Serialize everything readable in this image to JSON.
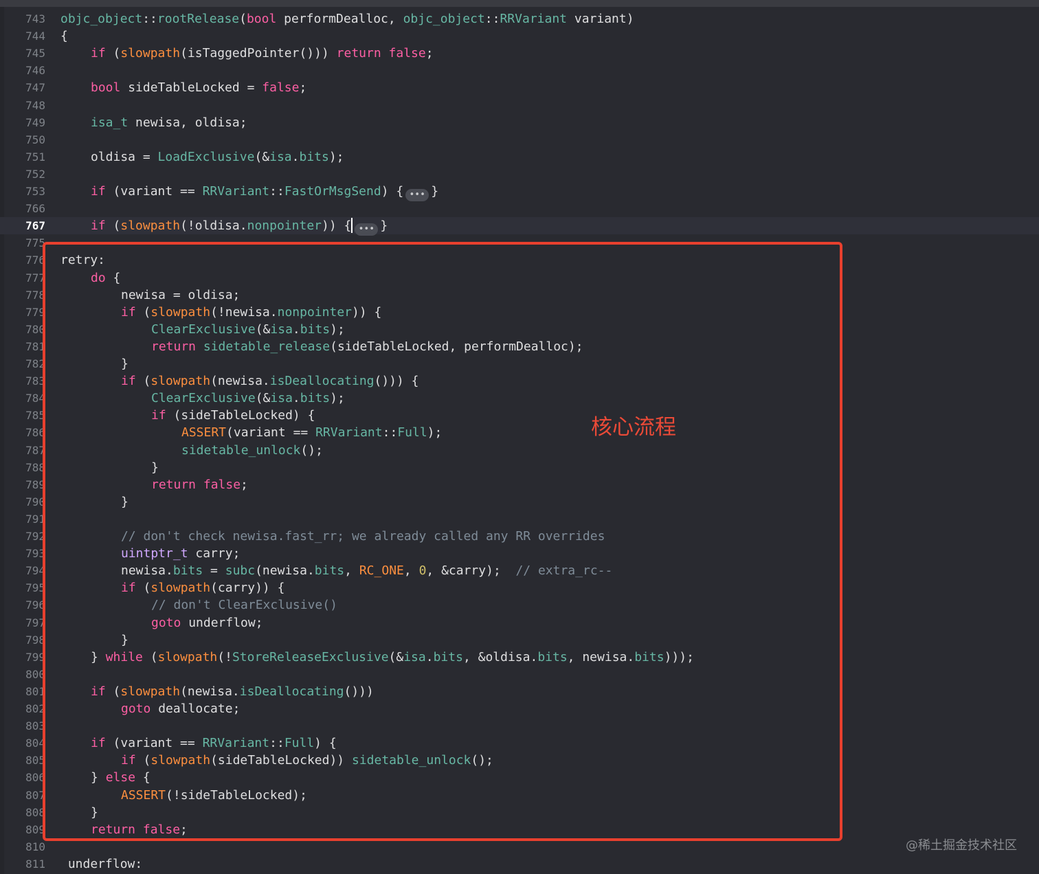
{
  "editor": {
    "current_line": "767",
    "fold_indicator": "•••"
  },
  "lines": [
    {
      "n": "743",
      "indent": 0,
      "tokens": [
        [
          "fn",
          "objc_object"
        ],
        [
          "pl",
          "::"
        ],
        [
          "fn",
          "rootRelease"
        ],
        [
          "pl",
          "("
        ],
        [
          "kw",
          "bool"
        ],
        [
          "pl",
          " performDealloc, "
        ],
        [
          "fn",
          "objc_object"
        ],
        [
          "pl",
          "::"
        ],
        [
          "fn",
          "RRVariant"
        ],
        [
          "pl",
          " variant)"
        ]
      ]
    },
    {
      "n": "744",
      "indent": 0,
      "tokens": [
        [
          "pl",
          "{"
        ]
      ]
    },
    {
      "n": "745",
      "indent": 1,
      "tokens": [
        [
          "kw",
          "if"
        ],
        [
          "pl",
          " ("
        ],
        [
          "mac",
          "slowpath"
        ],
        [
          "pl",
          "(isTaggedPointer())) "
        ],
        [
          "kw",
          "return false"
        ],
        [
          "pl",
          ";"
        ]
      ]
    },
    {
      "n": "746",
      "indent": 0,
      "tokens": []
    },
    {
      "n": "747",
      "indent": 1,
      "tokens": [
        [
          "kw",
          "bool"
        ],
        [
          "pl",
          " sideTableLocked = "
        ],
        [
          "kw",
          "false"
        ],
        [
          "pl",
          ";"
        ]
      ]
    },
    {
      "n": "748",
      "indent": 0,
      "tokens": []
    },
    {
      "n": "749",
      "indent": 1,
      "tokens": [
        [
          "fn",
          "isa_t"
        ],
        [
          "pl",
          " newisa, oldisa;"
        ]
      ]
    },
    {
      "n": "750",
      "indent": 0,
      "tokens": []
    },
    {
      "n": "751",
      "indent": 1,
      "tokens": [
        [
          "pl",
          "oldisa = "
        ],
        [
          "fn",
          "LoadExclusive"
        ],
        [
          "pl",
          "(&"
        ],
        [
          "fn",
          "isa"
        ],
        [
          "pl",
          "."
        ],
        [
          "fn",
          "bits"
        ],
        [
          "pl",
          ");"
        ]
      ]
    },
    {
      "n": "752",
      "indent": 0,
      "tokens": []
    },
    {
      "n": "753",
      "indent": 1,
      "tokens": [
        [
          "kw",
          "if"
        ],
        [
          "pl",
          " (variant == "
        ],
        [
          "fn",
          "RRVariant"
        ],
        [
          "pl",
          "::"
        ],
        [
          "fn",
          "FastOrMsgSend"
        ],
        [
          "pl",
          ") {"
        ],
        [
          "fold",
          ""
        ],
        [
          "pl",
          "}"
        ]
      ]
    },
    {
      "n": "766",
      "indent": 0,
      "tokens": []
    },
    {
      "n": "767",
      "indent": 1,
      "tokens": [
        [
          "kw",
          "if"
        ],
        [
          "pl",
          " ("
        ],
        [
          "mac",
          "slowpath"
        ],
        [
          "pl",
          "(!oldisa."
        ],
        [
          "fn",
          "nonpointer"
        ],
        [
          "pl",
          ")) {"
        ],
        [
          "caret",
          ""
        ],
        [
          "fold",
          ""
        ],
        [
          "pl",
          "}"
        ]
      ]
    },
    {
      "n": "775",
      "indent": 0,
      "tokens": []
    },
    {
      "n": "776",
      "indent": 0,
      "tokens": [
        [
          "pl",
          "retry:"
        ]
      ]
    },
    {
      "n": "777",
      "indent": 1,
      "tokens": [
        [
          "kw",
          "do"
        ],
        [
          "pl",
          " {"
        ]
      ]
    },
    {
      "n": "778",
      "indent": 2,
      "tokens": [
        [
          "pl",
          "newisa = oldisa;"
        ]
      ]
    },
    {
      "n": "779",
      "indent": 2,
      "tokens": [
        [
          "kw",
          "if"
        ],
        [
          "pl",
          " ("
        ],
        [
          "mac",
          "slowpath"
        ],
        [
          "pl",
          "(!newisa."
        ],
        [
          "fn",
          "nonpointer"
        ],
        [
          "pl",
          ")) {"
        ]
      ]
    },
    {
      "n": "780",
      "indent": 3,
      "tokens": [
        [
          "fn",
          "ClearExclusive"
        ],
        [
          "pl",
          "(&"
        ],
        [
          "fn",
          "isa"
        ],
        [
          "pl",
          "."
        ],
        [
          "fn",
          "bits"
        ],
        [
          "pl",
          ");"
        ]
      ]
    },
    {
      "n": "781",
      "indent": 3,
      "tokens": [
        [
          "kw",
          "return"
        ],
        [
          "pl",
          " "
        ],
        [
          "fn",
          "sidetable_release"
        ],
        [
          "pl",
          "(sideTableLocked, performDealloc);"
        ]
      ]
    },
    {
      "n": "782",
      "indent": 2,
      "tokens": [
        [
          "pl",
          "}"
        ]
      ]
    },
    {
      "n": "783",
      "indent": 2,
      "tokens": [
        [
          "kw",
          "if"
        ],
        [
          "pl",
          " ("
        ],
        [
          "mac",
          "slowpath"
        ],
        [
          "pl",
          "(newisa."
        ],
        [
          "fn",
          "isDeallocating"
        ],
        [
          "pl",
          "())) {"
        ]
      ]
    },
    {
      "n": "784",
      "indent": 3,
      "tokens": [
        [
          "fn",
          "ClearExclusive"
        ],
        [
          "pl",
          "(&"
        ],
        [
          "fn",
          "isa"
        ],
        [
          "pl",
          "."
        ],
        [
          "fn",
          "bits"
        ],
        [
          "pl",
          ");"
        ]
      ]
    },
    {
      "n": "785",
      "indent": 3,
      "tokens": [
        [
          "kw",
          "if"
        ],
        [
          "pl",
          " (sideTableLocked) {"
        ]
      ]
    },
    {
      "n": "786",
      "indent": 4,
      "tokens": [
        [
          "mac",
          "ASSERT"
        ],
        [
          "pl",
          "(variant == "
        ],
        [
          "fn",
          "RRVariant"
        ],
        [
          "pl",
          "::"
        ],
        [
          "fn",
          "Full"
        ],
        [
          "pl",
          ");"
        ]
      ]
    },
    {
      "n": "787",
      "indent": 4,
      "tokens": [
        [
          "fn",
          "sidetable_unlock"
        ],
        [
          "pl",
          "();"
        ]
      ]
    },
    {
      "n": "788",
      "indent": 3,
      "tokens": [
        [
          "pl",
          "}"
        ]
      ]
    },
    {
      "n": "789",
      "indent": 3,
      "tokens": [
        [
          "kw",
          "return false"
        ],
        [
          "pl",
          ";"
        ]
      ]
    },
    {
      "n": "790",
      "indent": 2,
      "tokens": [
        [
          "pl",
          "}"
        ]
      ]
    },
    {
      "n": "791",
      "indent": 0,
      "tokens": []
    },
    {
      "n": "792",
      "indent": 2,
      "tokens": [
        [
          "cm",
          "// don't check newisa.fast_rr; we already called any RR overrides"
        ]
      ]
    },
    {
      "n": "793",
      "indent": 2,
      "tokens": [
        [
          "ty",
          "uintptr_t"
        ],
        [
          "pl",
          " carry;"
        ]
      ]
    },
    {
      "n": "794",
      "indent": 2,
      "tokens": [
        [
          "pl",
          "newisa."
        ],
        [
          "fn",
          "bits"
        ],
        [
          "pl",
          " = "
        ],
        [
          "fn",
          "subc"
        ],
        [
          "pl",
          "(newisa."
        ],
        [
          "fn",
          "bits"
        ],
        [
          "pl",
          ", "
        ],
        [
          "mac",
          "RC_ONE"
        ],
        [
          "pl",
          ", "
        ],
        [
          "num",
          "0"
        ],
        [
          "pl",
          ", &carry);  "
        ],
        [
          "cm",
          "// extra_rc--"
        ]
      ]
    },
    {
      "n": "795",
      "indent": 2,
      "tokens": [
        [
          "kw",
          "if"
        ],
        [
          "pl",
          " ("
        ],
        [
          "mac",
          "slowpath"
        ],
        [
          "pl",
          "(carry)) {"
        ]
      ]
    },
    {
      "n": "796",
      "indent": 3,
      "tokens": [
        [
          "cm",
          "// don't ClearExclusive()"
        ]
      ]
    },
    {
      "n": "797",
      "indent": 3,
      "tokens": [
        [
          "kw",
          "goto"
        ],
        [
          "pl",
          " underflow;"
        ]
      ]
    },
    {
      "n": "798",
      "indent": 2,
      "tokens": [
        [
          "pl",
          "}"
        ]
      ]
    },
    {
      "n": "799",
      "indent": 1,
      "tokens": [
        [
          "pl",
          "} "
        ],
        [
          "kw",
          "while"
        ],
        [
          "pl",
          " ("
        ],
        [
          "mac",
          "slowpath"
        ],
        [
          "pl",
          "(!"
        ],
        [
          "fn",
          "StoreReleaseExclusive"
        ],
        [
          "pl",
          "(&"
        ],
        [
          "fn",
          "isa"
        ],
        [
          "pl",
          "."
        ],
        [
          "fn",
          "bits"
        ],
        [
          "pl",
          ", &oldisa."
        ],
        [
          "fn",
          "bits"
        ],
        [
          "pl",
          ", newisa."
        ],
        [
          "fn",
          "bits"
        ],
        [
          "pl",
          ")));"
        ]
      ]
    },
    {
      "n": "800",
      "indent": 0,
      "tokens": []
    },
    {
      "n": "801",
      "indent": 1,
      "tokens": [
        [
          "kw",
          "if"
        ],
        [
          "pl",
          " ("
        ],
        [
          "mac",
          "slowpath"
        ],
        [
          "pl",
          "(newisa."
        ],
        [
          "fn",
          "isDeallocating"
        ],
        [
          "pl",
          "()))"
        ]
      ]
    },
    {
      "n": "802",
      "indent": 2,
      "tokens": [
        [
          "kw",
          "goto"
        ],
        [
          "pl",
          " deallocate;"
        ]
      ]
    },
    {
      "n": "803",
      "indent": 0,
      "tokens": []
    },
    {
      "n": "804",
      "indent": 1,
      "tokens": [
        [
          "kw",
          "if"
        ],
        [
          "pl",
          " (variant == "
        ],
        [
          "fn",
          "RRVariant"
        ],
        [
          "pl",
          "::"
        ],
        [
          "fn",
          "Full"
        ],
        [
          "pl",
          ") {"
        ]
      ]
    },
    {
      "n": "805",
      "indent": 2,
      "tokens": [
        [
          "kw",
          "if"
        ],
        [
          "pl",
          " ("
        ],
        [
          "mac",
          "slowpath"
        ],
        [
          "pl",
          "(sideTableLocked)) "
        ],
        [
          "fn",
          "sidetable_unlock"
        ],
        [
          "pl",
          "();"
        ]
      ]
    },
    {
      "n": "806",
      "indent": 1,
      "tokens": [
        [
          "pl",
          "} "
        ],
        [
          "kw",
          "else"
        ],
        [
          "pl",
          " {"
        ]
      ]
    },
    {
      "n": "807",
      "indent": 2,
      "tokens": [
        [
          "mac",
          "ASSERT"
        ],
        [
          "pl",
          "(!sideTableLocked);"
        ]
      ]
    },
    {
      "n": "808",
      "indent": 1,
      "tokens": [
        [
          "pl",
          "}"
        ]
      ]
    },
    {
      "n": "809",
      "indent": 1,
      "tokens": [
        [
          "kw",
          "return false"
        ],
        [
          "pl",
          ";"
        ]
      ]
    },
    {
      "n": "810",
      "indent": 0,
      "tokens": []
    },
    {
      "n": "811",
      "indent": 0,
      "tokens": [
        [
          "pl",
          " underflow:"
        ]
      ]
    }
  ],
  "annotation": {
    "label": "核心流程",
    "color": "#e8402e"
  },
  "watermark": "@稀土掘金技术社区"
}
